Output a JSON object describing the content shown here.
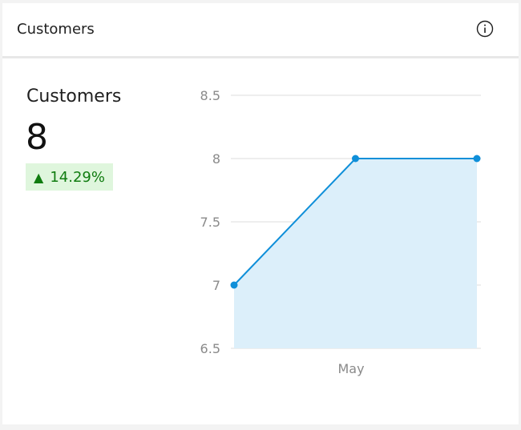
{
  "header": {
    "title": "Customers",
    "info_icon": "info-icon"
  },
  "kpi": {
    "label": "Customers",
    "value": "8",
    "change": "14.29%",
    "change_direction": "up",
    "change_color": "#107c10",
    "change_bg": "#dff6dd"
  },
  "chart_data": {
    "type": "area",
    "x": [
      0,
      1,
      2
    ],
    "categories_shown": [
      "May"
    ],
    "values": [
      7,
      8,
      8
    ],
    "ylim": [
      6.5,
      8.5
    ],
    "yticks": [
      "8.5",
      "8",
      "7.5",
      "7",
      "6.5"
    ],
    "xlabel": "",
    "ylabel": "",
    "title": "",
    "grid": true,
    "line_color": "#0f8fd9",
    "fill_color": "#dceffa"
  }
}
